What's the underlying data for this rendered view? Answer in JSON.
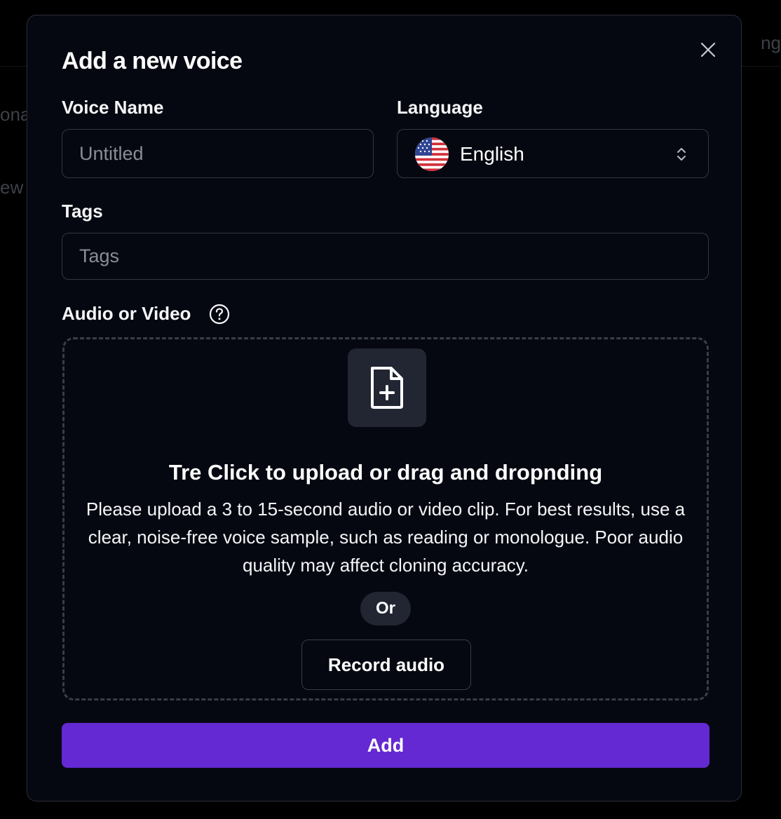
{
  "background": {
    "left_fragments": [
      "ona",
      "ew"
    ],
    "right_fragment": "ng"
  },
  "dialog": {
    "title": "Add a new voice",
    "close_icon": "close-icon",
    "voice_name": {
      "label": "Voice Name",
      "value": "",
      "placeholder": "Untitled"
    },
    "language": {
      "label": "Language",
      "selected": "English",
      "flag_icon": "us-flag-icon",
      "chevron_icon": "chevron-up-down-icon"
    },
    "tags": {
      "label": "Tags",
      "value": "",
      "placeholder": "Tags"
    },
    "media": {
      "label": "Audio or Video",
      "help_icon": "question-circle-icon",
      "upload_icon": "file-plus-icon",
      "drop_title": "Tre Click to upload or drag and dropnding",
      "drop_description": "Please upload a 3 to 15-second audio or video clip. For best results, use a clear, noise-free voice sample, such as reading or monologue. Poor audio quality may affect cloning accuracy.",
      "or_label": "Or",
      "record_label": "Record audio"
    },
    "submit_label": "Add"
  },
  "colors": {
    "page_background": "#000000",
    "dialog_background": "#060811",
    "border": "#33363e",
    "tile_background": "#222633",
    "accent": "#6429d2",
    "text": "#f4f5f7",
    "placeholder": "#8a8d96"
  }
}
